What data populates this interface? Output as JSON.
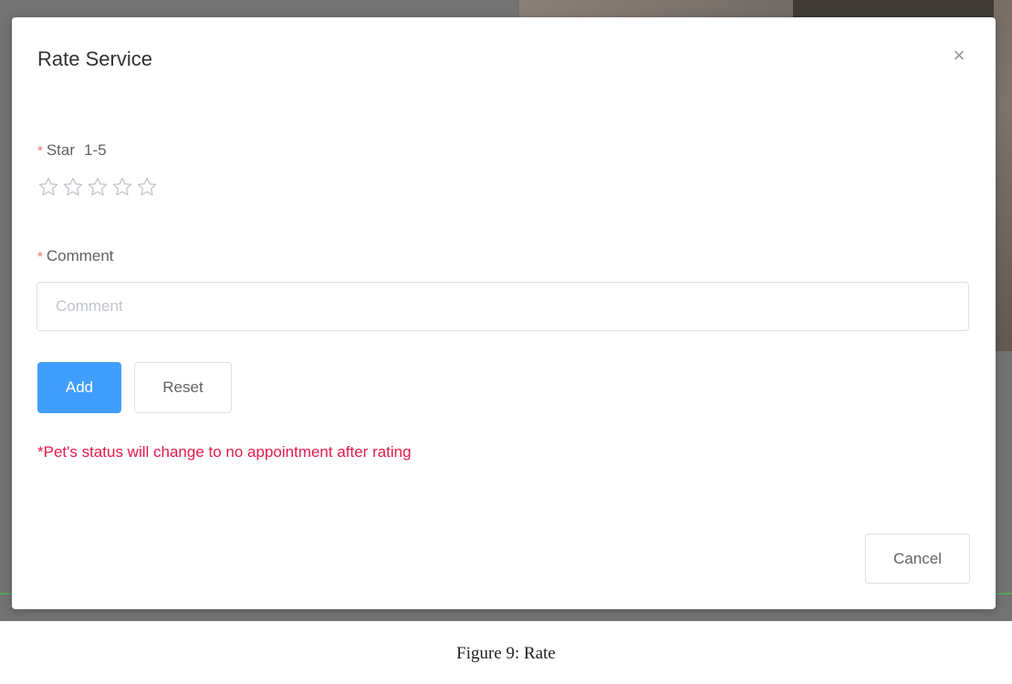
{
  "modal": {
    "title": "Rate Service",
    "close_icon": "close-icon"
  },
  "star_field": {
    "required_mark": "*",
    "label": "Star",
    "range": "1-5",
    "star_count": 5,
    "selected": 0,
    "star_icon": "star-outline-icon"
  },
  "comment_field": {
    "required_mark": "*",
    "label": "Comment",
    "placeholder": "Comment",
    "value": ""
  },
  "buttons": {
    "add": "Add",
    "reset": "Reset",
    "cancel": "Cancel"
  },
  "notice": "*Pet's status will change to no appointment after rating",
  "caption": "Figure 9: Rate",
  "colors": {
    "primary": "#409eff",
    "required": "#f56c6c",
    "notice": "#e6194b",
    "star_outline": "#c0c4cc"
  }
}
